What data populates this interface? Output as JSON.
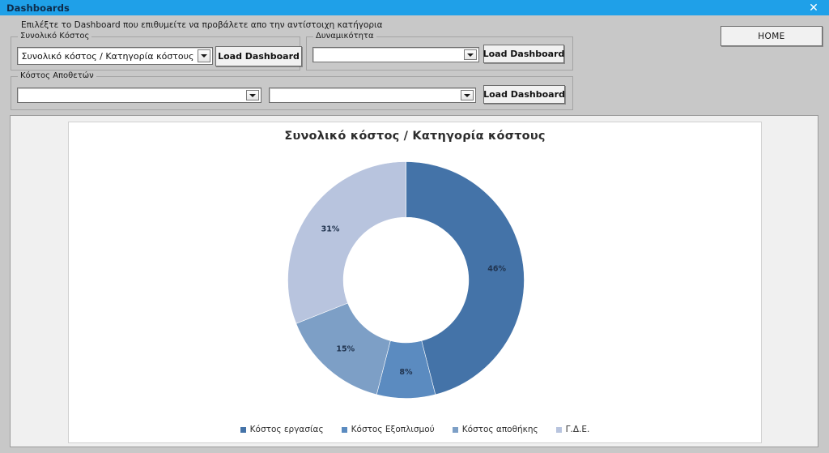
{
  "window": {
    "title": "Dashboards",
    "close_icon": "close-icon",
    "close_glyph": "✕",
    "titlebar_color": "#1fa0e8",
    "client_color": "#c8c8c8"
  },
  "header": {
    "instruction": "Επιλέξτε το Dashboard που επιθυμείτε να προβάλετε απο την αντίστοιχη κατήγορια",
    "home_label": "HOME"
  },
  "groups": {
    "total_cost": {
      "title": "Συνολικό Κόστος",
      "combo_value": "Συνολικό κόστος / Κατηγορία κόστους",
      "combo_placeholder": "",
      "load_label": "Load Dashboard"
    },
    "capacity": {
      "title": "Δυναμικότητα",
      "combo_value": "",
      "combo_placeholder": "",
      "load_label": "Load Dashboard"
    },
    "stock_cost": {
      "title": "Κόστος Αποθετών",
      "combo_a_value": "",
      "combo_a_placeholder": "",
      "combo_b_value": "",
      "combo_b_placeholder": "",
      "load_label": "Load Dashboard"
    }
  },
  "chart_data": {
    "type": "pie",
    "variant": "donut",
    "title": "Συνολικό κόστος / Κατηγορία  κόστους",
    "xlabel": "",
    "ylabel": "",
    "grid": false,
    "legend_position": "bottom",
    "start_angle_deg": 0,
    "direction": "clockwise",
    "inner_radius_ratio": 0.53,
    "categories": [
      "Κόστος εργασίας",
      "Κόστος Εξοπλισμού",
      "Κόστος αποθήκης",
      "Γ.Δ.Ε."
    ],
    "values": [
      46,
      8,
      15,
      31
    ],
    "data_labels": [
      "46%",
      "8%",
      "15%",
      "31%"
    ],
    "colors": [
      "#4473a8",
      "#5b8bc0",
      "#7d9fc6",
      "#b8c4de"
    ],
    "slices": [
      {
        "label": "Κόστος εργασίας",
        "value": 46,
        "data_label": "46%",
        "color": "#4473a8"
      },
      {
        "label": "Κόστος Εξοπλισμού",
        "value": 8,
        "data_label": "8%",
        "color": "#5b8bc0"
      },
      {
        "label": "Κόστος αποθήκης",
        "value": 15,
        "data_label": "15%",
        "color": "#7d9fc6"
      },
      {
        "label": "Γ.Δ.Ε.",
        "value": 31,
        "data_label": "31%",
        "color": "#b8c4de"
      }
    ]
  }
}
